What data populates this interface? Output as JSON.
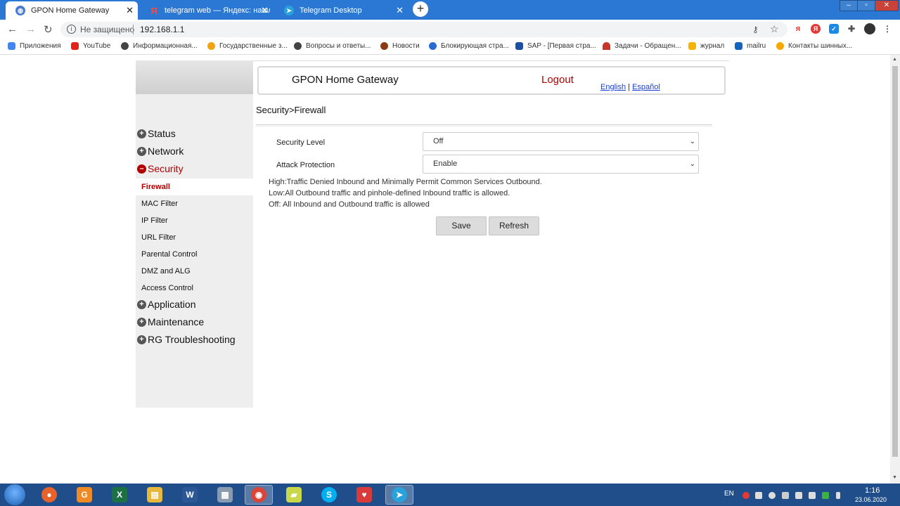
{
  "browser": {
    "tabs": [
      {
        "title": "GPON Home Gateway",
        "favicon_color": "#4a7bd0"
      },
      {
        "title": "telegram web — Яндекс: нашлось",
        "favicon_color": "#e53935"
      },
      {
        "title": "Telegram Desktop",
        "favicon_color": "#2aa3dd"
      }
    ],
    "new_tab_symbol": "+",
    "window_controls": {
      "minimize": "–",
      "maximize": "▫",
      "close": "✕"
    },
    "security_label": "Не защищено",
    "url": "192.168.1.1",
    "bookmarks": [
      {
        "label": "Приложения",
        "color": "#4285f4"
      },
      {
        "label": "YouTube",
        "color": "#e62117"
      },
      {
        "label": "Информационная...",
        "color": "#444444"
      },
      {
        "label": "Государственные з...",
        "color": "#f2a20c"
      },
      {
        "label": "Вопросы и ответы...",
        "color": "#444444"
      },
      {
        "label": "Новости",
        "color": "#8a3b12"
      },
      {
        "label": "Блокирующая стра...",
        "color": "#2a6bd1"
      },
      {
        "label": "SAP - [Первая стра...",
        "color": "#1a4fa3"
      },
      {
        "label": "Задачи - Обращен...",
        "color": "#c8352b"
      },
      {
        "label": "журнал",
        "color": "#f4b400"
      },
      {
        "label": "mailru",
        "color": "#1565c0"
      },
      {
        "label": "Контакты шинных...",
        "color": "#f6a800"
      }
    ]
  },
  "header": {
    "title": "GPON Home Gateway",
    "logout": "Logout",
    "lang_english": "English",
    "lang_separator": "|",
    "lang_spanish": "Español"
  },
  "sidebar": {
    "menu": [
      {
        "label": "Status",
        "toggle": "+"
      },
      {
        "label": "Network",
        "toggle": "+"
      },
      {
        "label": "Security",
        "toggle": "–"
      }
    ],
    "submenu": [
      {
        "label": "Firewall"
      },
      {
        "label": "MAC Filter"
      },
      {
        "label": "IP Filter"
      },
      {
        "label": "URL Filter"
      },
      {
        "label": "Parental Control"
      },
      {
        "label": "DMZ and ALG"
      },
      {
        "label": "Access Control"
      }
    ],
    "menu_after": [
      {
        "label": "Application",
        "toggle": "+"
      },
      {
        "label": "Maintenance",
        "toggle": "+"
      },
      {
        "label": "RG Troubleshooting",
        "toggle": "+"
      }
    ]
  },
  "main": {
    "breadcrumb": "Security>Firewall",
    "fields": [
      {
        "label": "Security Level",
        "value": "Off"
      },
      {
        "label": "Attack Protection",
        "value": "Enable"
      }
    ],
    "help": [
      "High:Traffic Denied Inbound and Minimally Permit Common Services Outbound.",
      "Low:All Outbound traffic and pinhole-defined Inbound traffic is allowed.",
      "Off: All Inbound and Outbound traffic is allowed"
    ],
    "save": "Save",
    "refresh": "Refresh"
  },
  "taskbar": {
    "apps": [
      {
        "name": "firefox",
        "glyph": "●",
        "color": "#e8632b"
      },
      {
        "name": "g-pdf",
        "glyph": "G",
        "color": "#f08a24"
      },
      {
        "name": "excel",
        "glyph": "X",
        "color": "#1d7044"
      },
      {
        "name": "explorer",
        "glyph": "▤",
        "color": "#e8b83c"
      },
      {
        "name": "word",
        "glyph": "W",
        "color": "#2b5797"
      },
      {
        "name": "calculator",
        "glyph": "▦",
        "color": "#8a9bb0"
      },
      {
        "name": "chrome",
        "glyph": "◉",
        "color": "#db4437"
      },
      {
        "name": "notes",
        "glyph": "▰",
        "color": "#c8d84a"
      },
      {
        "name": "skype",
        "glyph": "S",
        "color": "#00aff0"
      },
      {
        "name": "antivirus",
        "glyph": "♥",
        "color": "#d93b3b"
      },
      {
        "name": "telegram",
        "glyph": "➤",
        "color": "#2aa3dd"
      }
    ],
    "language": "EN",
    "time": "1:16",
    "date": "23.06.2020"
  }
}
